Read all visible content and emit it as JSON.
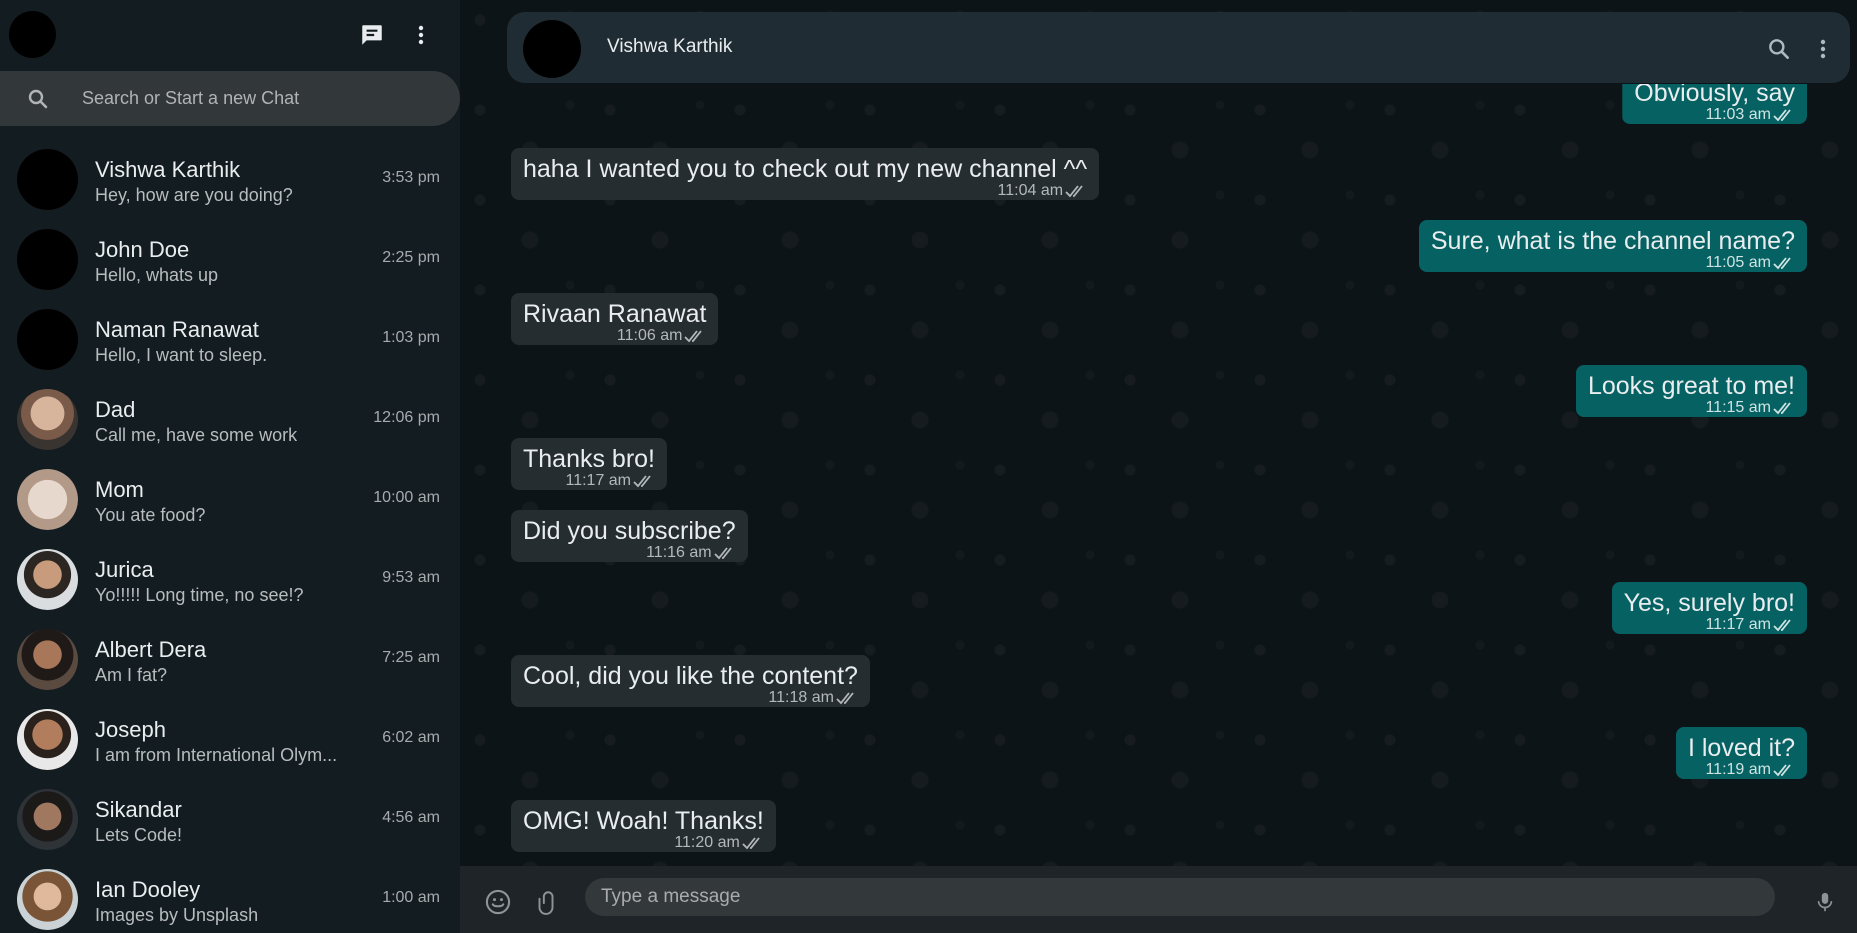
{
  "sidebar": {
    "search_placeholder": "Search or Start a new Chat",
    "chats": [
      {
        "name": "Vishwa Karthik",
        "preview": "Hey, how are you doing?",
        "time": "3:53 pm",
        "avatar": "black"
      },
      {
        "name": "John Doe",
        "preview": "Hello, whats up",
        "time": "2:25 pm",
        "avatar": "black"
      },
      {
        "name": "Naman Ranawat",
        "preview": "Hello, I want to sleep.",
        "time": "1:03 pm",
        "avatar": "black"
      },
      {
        "name": "Dad",
        "preview": "Call me, have some work",
        "time": "12:06 pm",
        "avatar": "photo"
      },
      {
        "name": "Mom",
        "preview": "You ate food?",
        "time": "10:00 am",
        "avatar": "photo"
      },
      {
        "name": "Jurica",
        "preview": "Yo!!!!! Long time, no see!?",
        "time": "9:53 am",
        "avatar": "photo"
      },
      {
        "name": "Albert Dera",
        "preview": "Am I fat?",
        "time": "7:25 am",
        "avatar": "photo"
      },
      {
        "name": "Joseph",
        "preview": "I am from International Olym...",
        "time": "6:02 am",
        "avatar": "photo"
      },
      {
        "name": "Sikandar",
        "preview": "Lets Code!",
        "time": "4:56 am",
        "avatar": "photo"
      },
      {
        "name": "Ian Dooley",
        "preview": "Images by Unsplash",
        "time": "1:00 am",
        "avatar": "photo"
      }
    ]
  },
  "chat": {
    "contact_name": "Vishwa Karthik",
    "messages": [
      {
        "dir": "out",
        "text": "Obviously, say",
        "time": "11:03 am"
      },
      {
        "dir": "in",
        "text": "haha I wanted you to check out my new channel ^^",
        "time": "11:04 am"
      },
      {
        "dir": "out",
        "text": "Sure, what is the channel name?",
        "time": "11:05 am"
      },
      {
        "dir": "in",
        "text": "Rivaan Ranawat",
        "time": "11:06 am"
      },
      {
        "dir": "out",
        "text": "Looks great to me!",
        "time": "11:15 am"
      },
      {
        "dir": "in",
        "text": "Thanks bro!",
        "time": "11:17 am"
      },
      {
        "dir": "in",
        "text": "Did you subscribe?",
        "time": "11:16 am"
      },
      {
        "dir": "out",
        "text": "Yes, surely bro!",
        "time": "11:17 am"
      },
      {
        "dir": "in",
        "text": "Cool, did you like the content?",
        "time": "11:18 am"
      },
      {
        "dir": "out",
        "text": "I loved it?",
        "time": "11:19 am"
      },
      {
        "dir": "in",
        "text": "OMG! Woah! Thanks!",
        "time": "11:20 am"
      }
    ]
  },
  "footer": {
    "input_placeholder": "Type a message"
  },
  "colors": {
    "sidebar_bg": "#131c21",
    "main_bg": "#0d1418",
    "incoming_bubble": "#262d31",
    "outgoing_bubble": "#056162",
    "header_bg": "#202c33"
  },
  "icons": [
    "new-chat-icon",
    "menu-icon",
    "search-icon",
    "emoji-icon",
    "attach-icon",
    "mic-icon",
    "double-tick-icon"
  ]
}
